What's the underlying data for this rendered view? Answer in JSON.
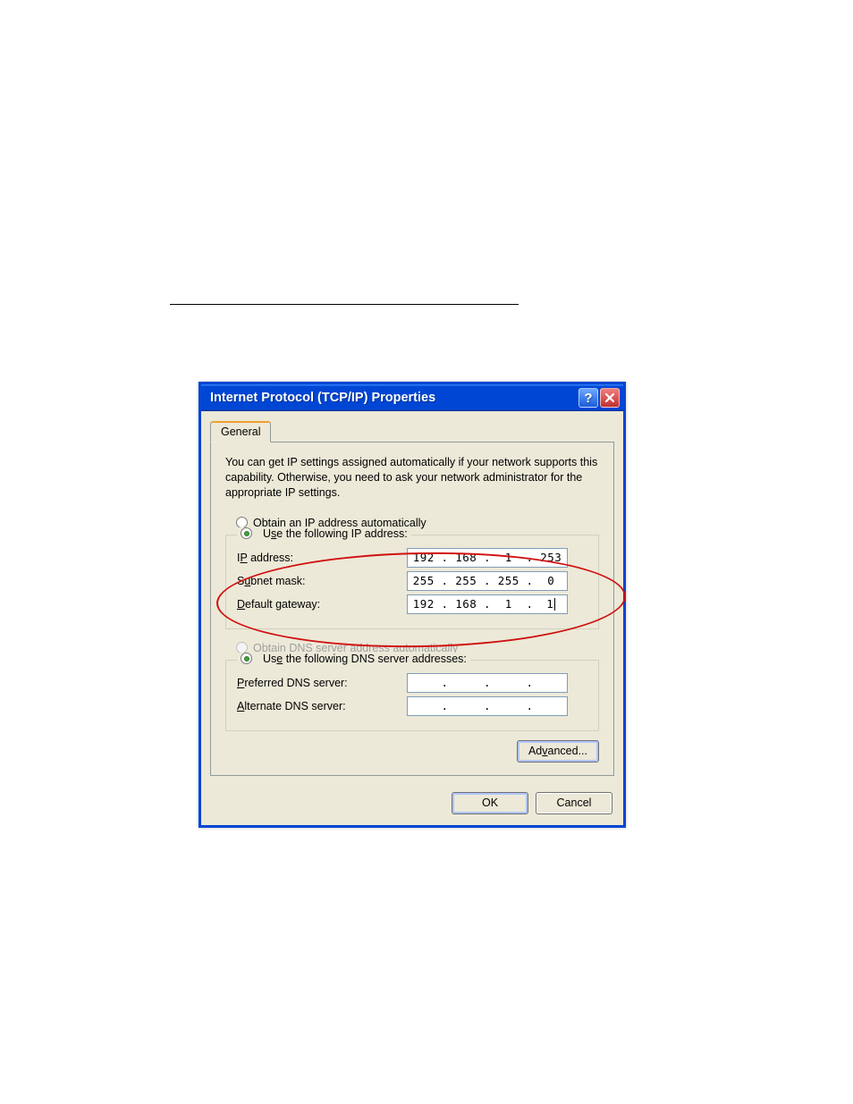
{
  "dialog": {
    "title": "Internet Protocol (TCP/IP) Properties",
    "tab_label": "General",
    "intro": "You can get IP settings assigned automatically if your network supports this capability. Otherwise, you need to ask your network administrator for the appropriate IP settings.",
    "radio_obtain_ip_prefix": "O",
    "radio_obtain_ip_rest": "btain an IP address automatically",
    "radio_use_ip_prefix": "s",
    "radio_use_ip_pre": "U",
    "radio_use_ip_rest": "e the following IP address:",
    "ip_rows": {
      "ip_address": {
        "label_pre": "I",
        "label_u": "P",
        "label_post": " address:",
        "o1": "192",
        "o2": "168",
        "o3": "1",
        "o4": "253"
      },
      "subnet": {
        "label_pre": "S",
        "label_u": "u",
        "label_post": "bnet mask:",
        "o1": "255",
        "o2": "255",
        "o3": "255",
        "o4": "0"
      },
      "gateway": {
        "label_u": "D",
        "label_post": "efault gateway:",
        "o1": "192",
        "o2": "168",
        "o3": "1",
        "o4": "1"
      }
    },
    "radio_obtain_dns_pre": "O",
    "radio_obtain_dns_u": "b",
    "radio_obtain_dns_rest": "tain DNS server address automatically",
    "radio_use_dns_pre": "Us",
    "radio_use_dns_u": "e",
    "radio_use_dns_rest": " the following DNS server addresses:",
    "dns_rows": {
      "preferred": {
        "label_u": "P",
        "label_post": "referred DNS server:"
      },
      "alternate": {
        "label_u": "A",
        "label_post": "lternate DNS server:"
      }
    },
    "advanced_pre": "Ad",
    "advanced_u": "v",
    "advanced_post": "anced...",
    "ok": "OK",
    "cancel": "Cancel"
  }
}
